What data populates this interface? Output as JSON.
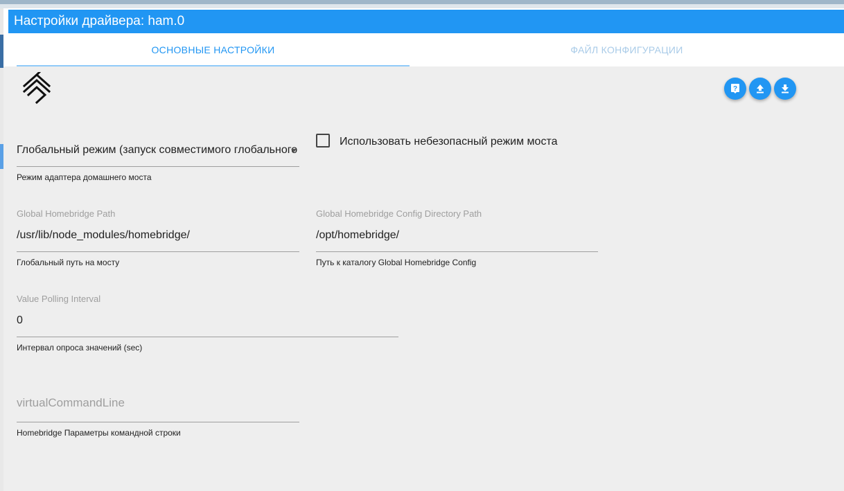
{
  "window": {
    "title": "Настройки драйвера: ham.0"
  },
  "tabs": [
    {
      "label": "ОСНОВНЫЕ НАСТРОЙКИ",
      "active": true
    },
    {
      "label": "ФАЙЛ КОНФИГУРАЦИИ",
      "active": false
    }
  ],
  "toolbar": {
    "help_icon": "help-icon",
    "upload_icon": "upload-icon",
    "download_icon": "download-icon",
    "accent_color": "#2196f3"
  },
  "form": {
    "bridge_mode": {
      "value": "Глобальный режим (запуск совместимого глобального",
      "helper": "Режим адаптера домашнего моста"
    },
    "insecure_mode": {
      "label": "Использовать небезопасный режим моста",
      "checked": false
    },
    "global_path": {
      "label": "Global Homebridge Path",
      "value": "/usr/lib/node_modules/homebridge/",
      "helper": "Глобальный путь на мосту"
    },
    "config_path": {
      "label": "Global Homebridge Config Directory Path",
      "value": "/opt/homebridge/",
      "helper": "Путь к каталогу Global Homebridge Config"
    },
    "polling_interval": {
      "label": "Value Polling Interval",
      "value": "0",
      "helper": "Интервал опроса значений (sec)"
    },
    "command_line": {
      "placeholder": "virtualCommandLine",
      "helper": "Homebridge Параметры командной строки"
    }
  }
}
